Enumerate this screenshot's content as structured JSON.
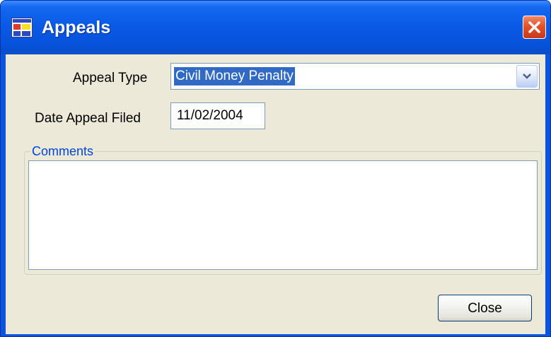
{
  "window": {
    "title": "Appeals",
    "app_icon": "form-window-icon",
    "close_icon": "close-x-icon"
  },
  "form": {
    "appeal_type_label": "Appeal Type",
    "appeal_type_value": "Civil Money Penalty",
    "dropdown_icon": "chevron-down-icon",
    "date_filed_label": "Date Appeal Filed",
    "date_filed_value": "11/02/2004",
    "comments_label": "Comments",
    "comments_value": ""
  },
  "buttons": {
    "close_label": "Close"
  },
  "colors": {
    "titlebar": "#0a55e0",
    "client_bg": "#ece9d8",
    "selection": "#316ac5",
    "group_label": "#0046d5",
    "close_button_red": "#e2522a"
  }
}
